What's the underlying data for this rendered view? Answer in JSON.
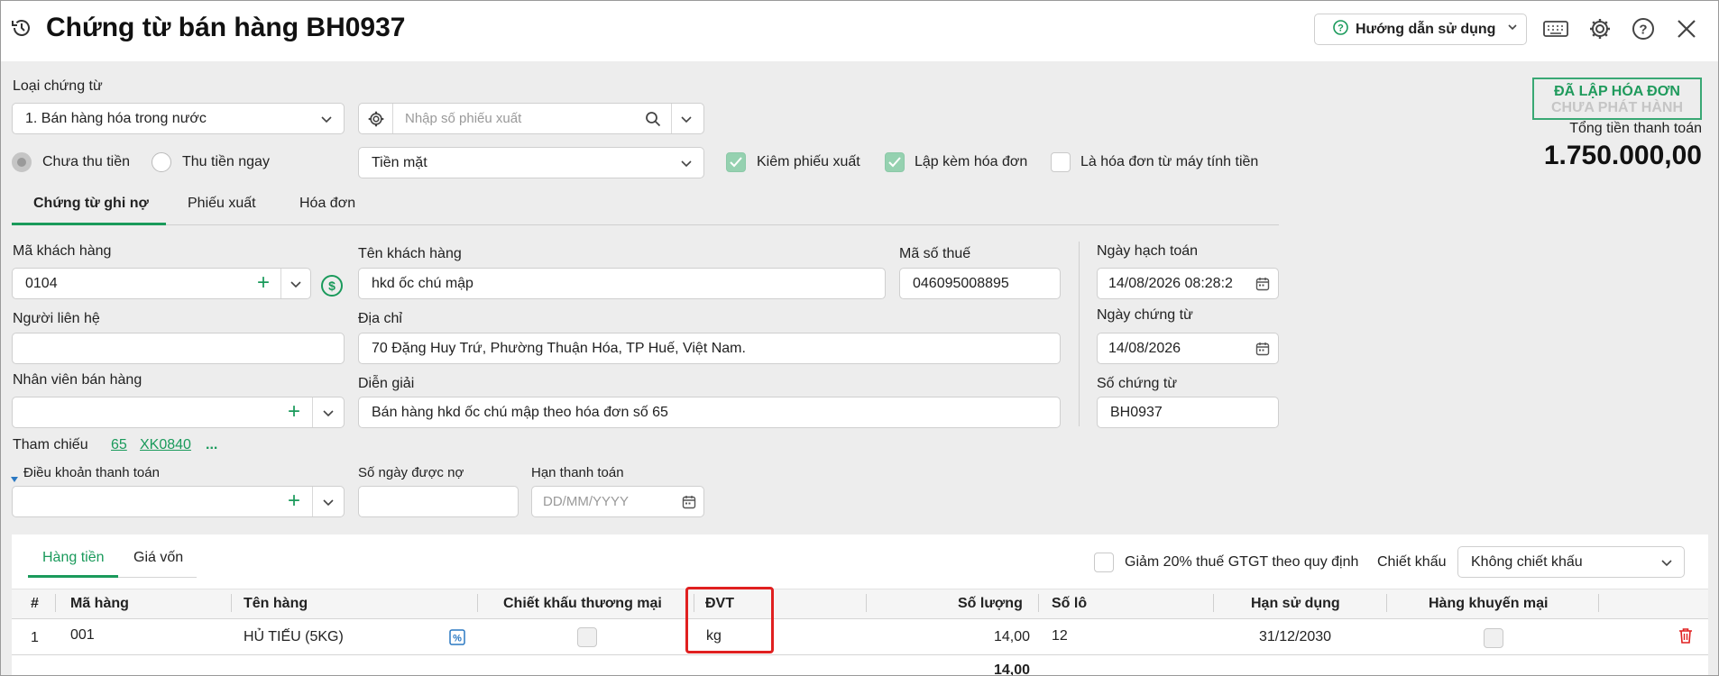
{
  "header": {
    "title": "Chứng từ bán hàng BH0937",
    "help_label": "Hướng dẫn sử dụng"
  },
  "form": {
    "voucher_type_label": "Loại chứng từ",
    "voucher_type_value": "1. Bán hàng hóa trong nước",
    "export_no_placeholder": "Nhập số phiếu xuất",
    "radio_unpaid": "Chưa thu tiền",
    "radio_paid_now": "Thu tiền ngay",
    "payment_method": "Tiền mặt",
    "chk_export_slip": "Kiêm phiếu xuất",
    "chk_with_invoice": "Lập kèm hóa đơn",
    "chk_cash_register": "Là hóa đơn từ máy tính tiền"
  },
  "status": {
    "stamp_line1": "ĐÃ LẬP HÓA ĐƠN",
    "stamp_line2": "CHƯA PHÁT HÀNH",
    "total_label": "Tổng tiền thanh toán",
    "total_value": "1.750.000,00"
  },
  "tabs": [
    "Chứng từ ghi nợ",
    "Phiếu xuất",
    "Hóa đơn"
  ],
  "customer": {
    "code_label": "Mã khách hàng",
    "code_value": "0104",
    "name_label": "Tên khách hàng",
    "name_value": "hkd ốc chú mập",
    "tax_label": "Mã số thuế",
    "tax_value": "046095008895",
    "contact_label": "Người liên hệ",
    "address_label": "Địa chỉ",
    "address_value": "70 Đặng Huy Trứ, Phường Thuận Hóa, TP Huế, Việt Nam.",
    "staff_label": "Nhân viên bán hàng",
    "desc_label": "Diễn giải",
    "desc_value": "Bán hàng hkd ốc chú mập theo hóa đơn số 65",
    "ref_label": "Tham chiếu",
    "ref1": "65",
    "ref2": "XK0840",
    "ref_more": "...",
    "terms_label": "Điều khoản thanh toán",
    "days_label": "Số ngày được nợ",
    "due_label": "Hạn thanh toán",
    "due_placeholder": "DD/MM/YYYY"
  },
  "dates": {
    "posting_label": "Ngày hạch toán",
    "posting_value": "14/08/2026 08:28:2",
    "voucher_date_label": "Ngày chứng từ",
    "voucher_date_value": "14/08/2026",
    "voucher_no_label": "Số chứng từ",
    "voucher_no_value": "BH0937"
  },
  "grid": {
    "tabs": [
      "Hàng tiền",
      "Giá vốn"
    ],
    "vat_reduction_label": "Giảm 20% thuế GTGT theo quy định",
    "discount_label": "Chiết khấu",
    "discount_value": "Không chiết khấu",
    "columns": [
      "#",
      "Mã hàng",
      "Tên hàng",
      "Chiết khấu thương mại",
      "ĐVT",
      "Số lượng",
      "Số lô",
      "Hạn sử dụng",
      "Hàng khuyến mại"
    ],
    "rows": [
      {
        "no": "1",
        "code": "001",
        "name": "HỦ TIẾU (5KG)",
        "unit": "kg",
        "qty": "14,00",
        "lot": "12",
        "expiry": "31/12/2030"
      }
    ],
    "total_qty": "14,00"
  },
  "colors": {
    "accent": "#1a9a5b",
    "highlight": "#e02020"
  }
}
